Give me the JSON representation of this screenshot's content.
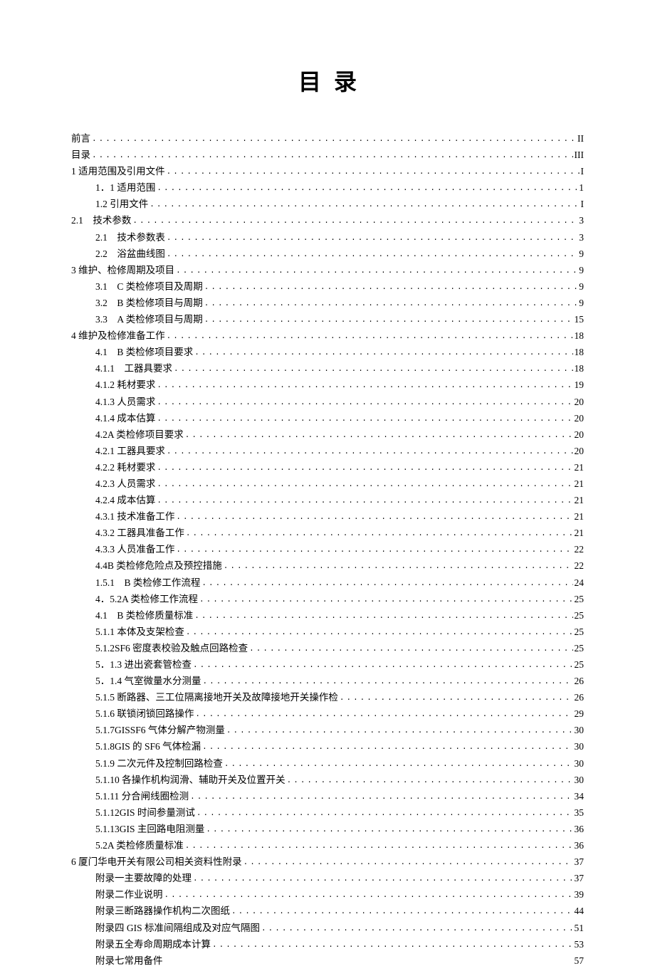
{
  "title": "目录",
  "toc": [
    {
      "level": 0,
      "label": "前言",
      "page": "II"
    },
    {
      "level": 0,
      "label": "目录",
      "page": "III"
    },
    {
      "level": 0,
      "label": "1 适用范围及引用文件",
      "page": "I"
    },
    {
      "level": 1,
      "label": "1．1 适用范围",
      "page": "1"
    },
    {
      "level": 1,
      "label": "1.2 引用文件",
      "page": "I"
    },
    {
      "level": 0,
      "label": "2.1 技术参数",
      "page": "3"
    },
    {
      "level": 1,
      "label": "2.1 技术参数表",
      "page": "3"
    },
    {
      "level": 1,
      "label": "2.2 浴盆曲线图",
      "page": "9"
    },
    {
      "level": 0,
      "label": "3 维护、检修周期及项目",
      "page": "9"
    },
    {
      "level": 1,
      "label": "3.1 C 类检修项目及周期",
      "page": "9"
    },
    {
      "level": 1,
      "label": "3.2 B 类检修项目与周期",
      "page": "9"
    },
    {
      "level": 1,
      "label": "3.3 A 类检修项目与周期",
      "page": "15"
    },
    {
      "level": 0,
      "label": "4 维护及检修准备工作",
      "page": "18"
    },
    {
      "level": 1,
      "label": "4.1 B 类检修项目要求",
      "page": "18"
    },
    {
      "level": 1,
      "label": "4.1.1 工器具要求",
      "page": "18"
    },
    {
      "level": 1,
      "label": "4.1.2 耗材要求",
      "page": "19"
    },
    {
      "level": 1,
      "label": "4.1.3 人员需求",
      "page": "20"
    },
    {
      "level": 1,
      "label": "4.1.4 成本估算",
      "page": "20"
    },
    {
      "level": 1,
      "label": "4.2A 类检修项目要求",
      "page": "20"
    },
    {
      "level": 1,
      "label": "4.2.1 工器具要求",
      "page": "20"
    },
    {
      "level": 1,
      "label": "4.2.2 耗材要求",
      "page": "21"
    },
    {
      "level": 1,
      "label": "4.2.3 人员需求",
      "page": "21"
    },
    {
      "level": 1,
      "label": "4.2.4 成本估算",
      "page": "21"
    },
    {
      "level": 1,
      "label": "4.3.1 技术准备工作",
      "page": "21"
    },
    {
      "level": 1,
      "label": "4.3.2 工器具准备工作",
      "page": "21"
    },
    {
      "level": 1,
      "label": "4.3.3 人员准备工作",
      "page": "22"
    },
    {
      "level": 1,
      "label": "4.4B 类检修危险点及预控措施",
      "page": "22"
    },
    {
      "level": 1,
      "label": "1.5.1 B 类检修工作流程",
      "page": "24"
    },
    {
      "level": 1,
      "label": "4．5.2A 类检修工作流程",
      "page": "25"
    },
    {
      "level": 1,
      "label": "4.1 B 类检修质量标准",
      "page": "25"
    },
    {
      "level": 1,
      "label": "5.1.1 本体及支架检查",
      "page": "25"
    },
    {
      "level": 1,
      "label": "5.1.2SF6 密度表校验及触点回路检查",
      "page": "25"
    },
    {
      "level": 1,
      "label": "5．1.3 进出瓷套管检查",
      "page": "25"
    },
    {
      "level": 1,
      "label": "5．1.4 气室微量水分测量",
      "page": "26"
    },
    {
      "level": 1,
      "label": "5.1.5 断路器、三工位隔离接地开关及故障接地开关操作检",
      "page": "26"
    },
    {
      "level": 1,
      "label": "5.1.6 联锁闭锁回路操作",
      "page": "29"
    },
    {
      "level": 1,
      "label": "5.1.7GISSF6 气体分解产物测量",
      "page": "30"
    },
    {
      "level": 1,
      "label": "5.1.8GIS 的 SF6 气体检漏",
      "page": "30"
    },
    {
      "level": 1,
      "label": "5.1.9 二次元件及控制回路检查",
      "page": "30"
    },
    {
      "level": 1,
      "label": "5.1.10 各操作机构润滑、辅助开关及位置开关",
      "page": "30"
    },
    {
      "level": 1,
      "label": "5.1.11 分合闸线圈检测",
      "page": "34"
    },
    {
      "level": 1,
      "label": "5.1.12GIS 时间参量测试",
      "page": "35"
    },
    {
      "level": 1,
      "label": "5.1.13GIS 主回路电阻测量",
      "page": "36"
    },
    {
      "level": 1,
      "label": "5.2A 类检修质量标准",
      "page": "36"
    },
    {
      "level": 0,
      "label": "6 厦门华电开关有限公司相关资料性附录",
      "page": "37"
    },
    {
      "level": 1,
      "label": "附录一主要故障的处理",
      "page": "37"
    },
    {
      "level": 1,
      "label": "附录二作业说明",
      "page": "39"
    },
    {
      "level": 1,
      "label": "附录三断路器操作机构二次图纸",
      "page": "44"
    },
    {
      "level": 1,
      "label": "附录四 GIS 标准间隔组成及对应气隔图",
      "page": "51"
    },
    {
      "level": 1,
      "label": "附录五全寿命周期成本计算",
      "page": "53"
    },
    {
      "level": 1,
      "label": "附录七常用备件",
      "page": "57",
      "noDots": true
    }
  ]
}
